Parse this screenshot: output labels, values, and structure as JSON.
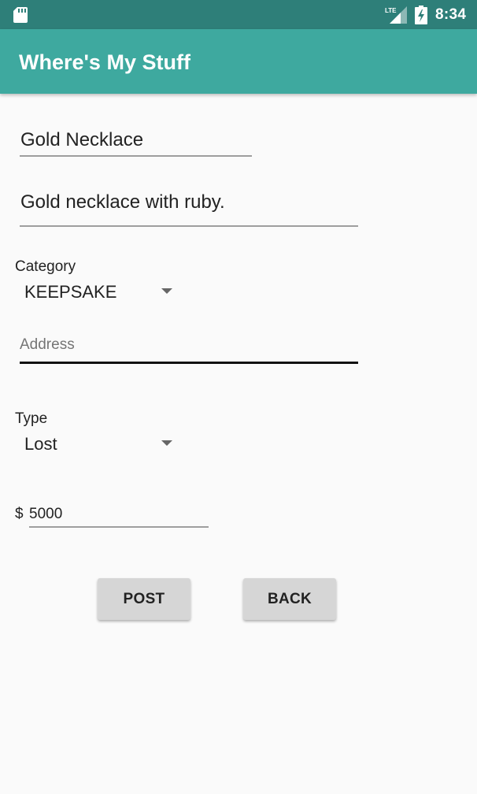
{
  "status_bar": {
    "network_label": "LTE",
    "time": "8:34",
    "icons": [
      "sd-card-icon",
      "lte-signal-icon",
      "battery-charging-icon"
    ]
  },
  "app_bar": {
    "title": "Where's My Stuff"
  },
  "form": {
    "name": {
      "value": "Gold Necklace"
    },
    "description": {
      "value": "Gold necklace with ruby."
    },
    "category": {
      "label": "Category",
      "selected": "KEEPSAKE"
    },
    "address": {
      "placeholder": "Address",
      "value": ""
    },
    "type": {
      "label": "Type",
      "selected": "Lost"
    },
    "reward": {
      "currency": "$",
      "value": "5000"
    }
  },
  "buttons": {
    "post": "POST",
    "back": "BACK"
  },
  "colors": {
    "status_bar": "#2e7f79",
    "app_bar": "#3ea99f",
    "background": "#fafafa",
    "button": "#d6d6d6"
  }
}
